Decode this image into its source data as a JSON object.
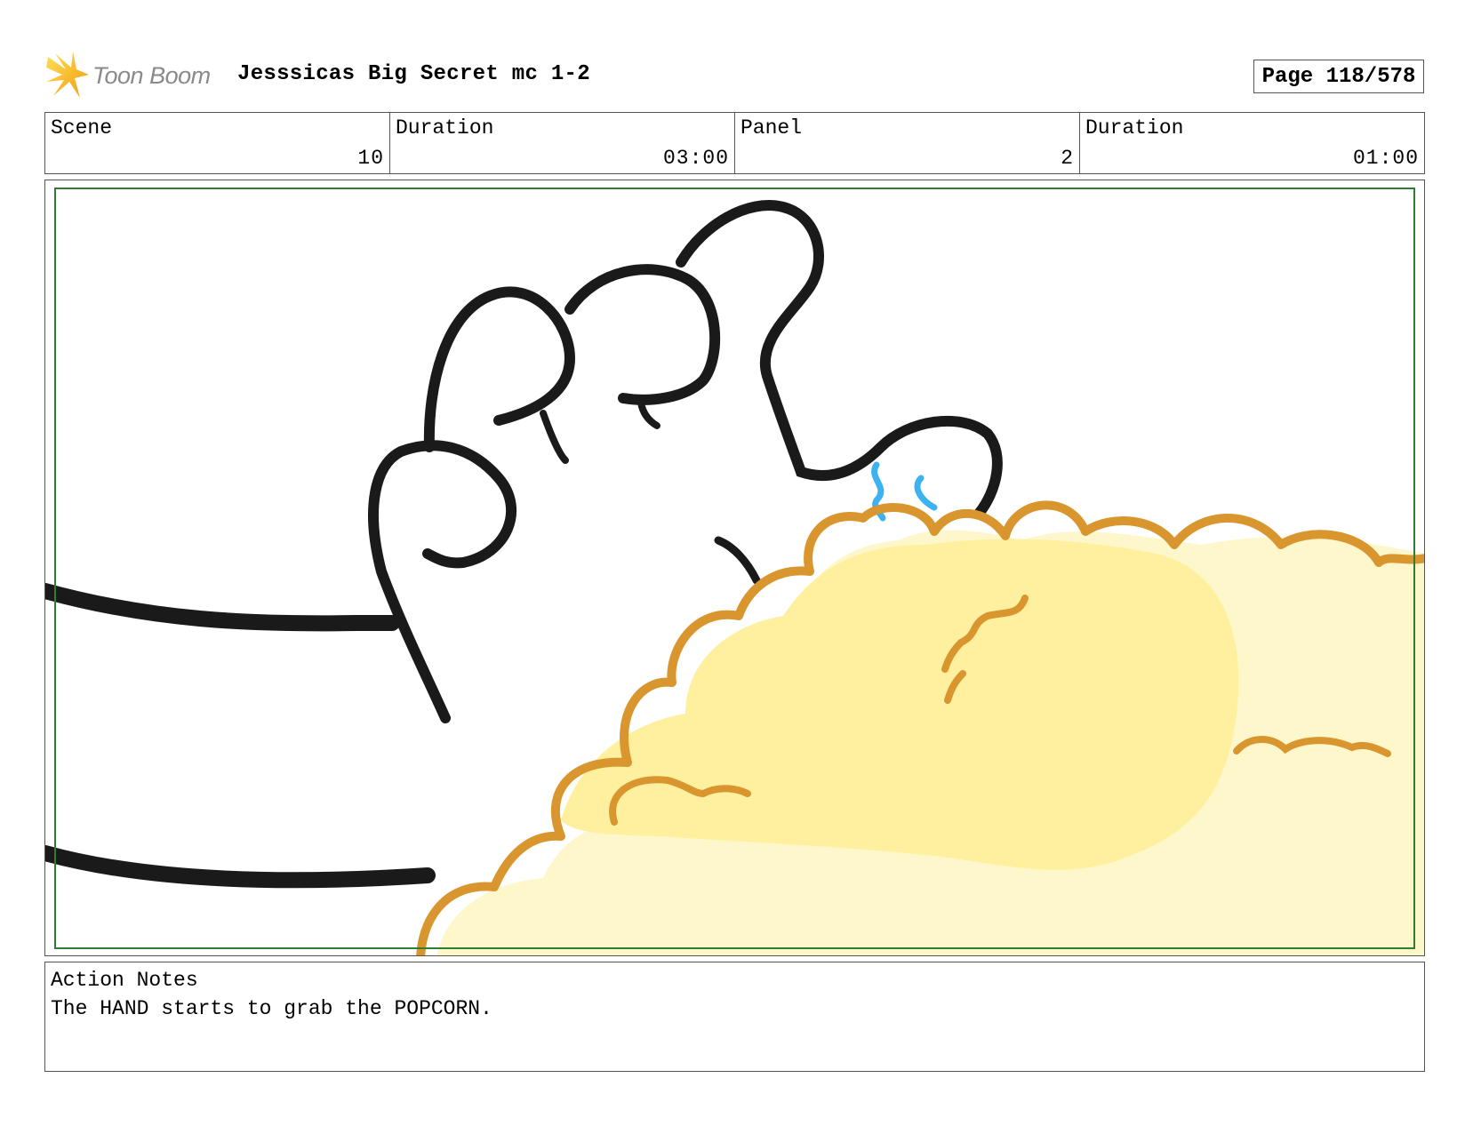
{
  "header": {
    "logo_text": "Toon Boom",
    "title": "Jesssicas Big Secret mc 1-2",
    "page_label": "Page 118/578"
  },
  "info": {
    "scene_label": "Scene",
    "scene_value": "10",
    "scene_duration_label": "Duration",
    "scene_duration_value": "03:00",
    "panel_label": "Panel",
    "panel_value": "2",
    "panel_duration_label": "Duration",
    "panel_duration_value": "01:00"
  },
  "notes": {
    "label": "Action Notes",
    "text": "The HAND starts to grab the POPCORN."
  },
  "colors": {
    "safe_area_border": "#2e7d32",
    "line_art": "#1a1a1a",
    "popcorn_outline": "#d9962e",
    "popcorn_fill": "#fff0a0",
    "popcorn_fill_light": "#fff7cc",
    "sweat_blue": "#3db2f0",
    "logo_yellow": "#f7c414"
  },
  "icons": {
    "logo": "toon-boom-star-burst-icon"
  }
}
